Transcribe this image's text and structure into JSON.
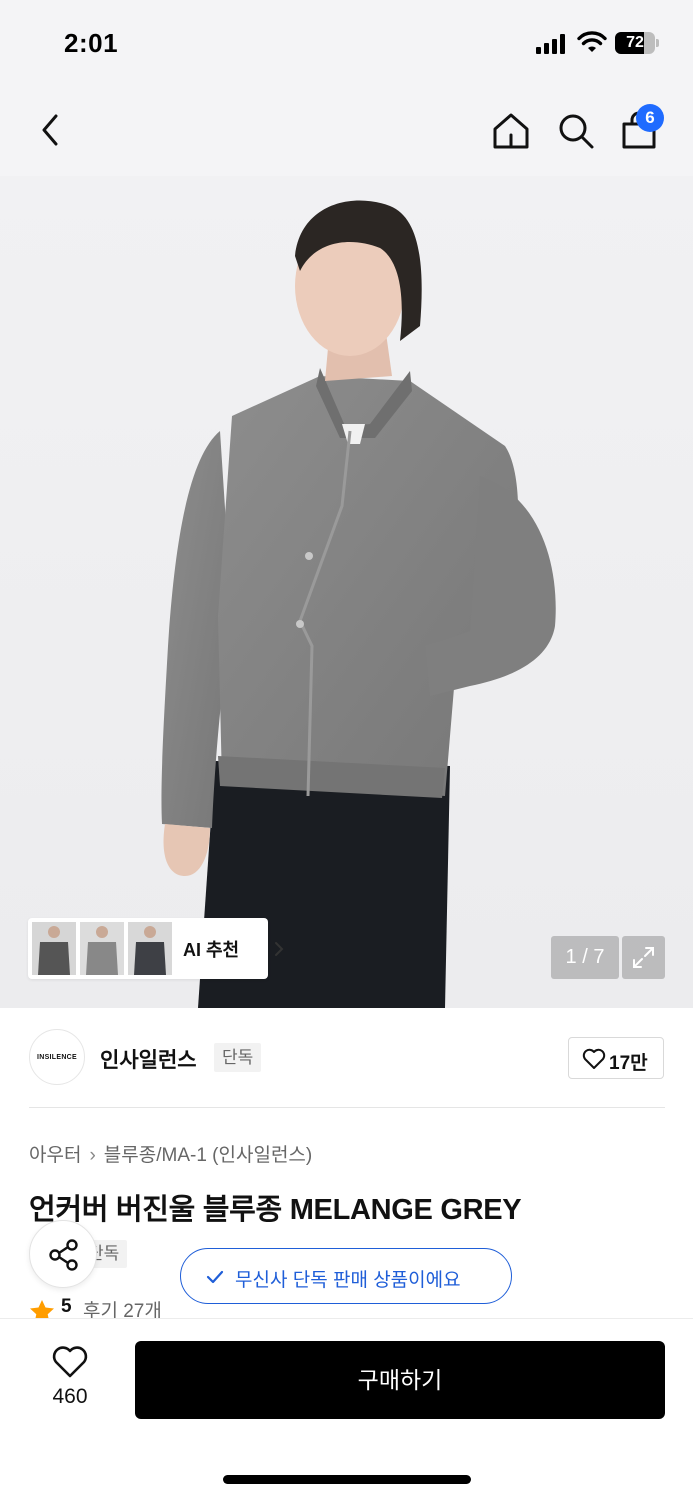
{
  "status_bar": {
    "time": "2:01",
    "battery": "72",
    "battery_level": 0.72
  },
  "nav": {
    "back_icon": "chevron-left-icon",
    "home_icon": "home-icon",
    "search_icon": "search-icon",
    "cart_icon": "shopping-bag-icon",
    "cart_badge": "6",
    "badge_color": "#1f6bff"
  },
  "gallery": {
    "ai_label": "AI 추천",
    "pager": "1 / 7",
    "expand_icon": "expand-icon"
  },
  "brand": {
    "logo_text": "INSILENCE",
    "name": "인사일런스",
    "tag": "단독",
    "like_count": "17만"
  },
  "product": {
    "breadcrumb": [
      "아우터",
      "블루종/MA-1 (인사일런스)"
    ],
    "title": "언커버 버진울 블루종 MELANGE GREY",
    "tag": "단독",
    "rating": "5",
    "reviews": "후기 27개"
  },
  "toast": {
    "text": "무신사 단독 판매 상품이에요",
    "color": "#1f5ed8"
  },
  "bottom": {
    "wish_count": "460",
    "buy_label": "구매하기"
  }
}
